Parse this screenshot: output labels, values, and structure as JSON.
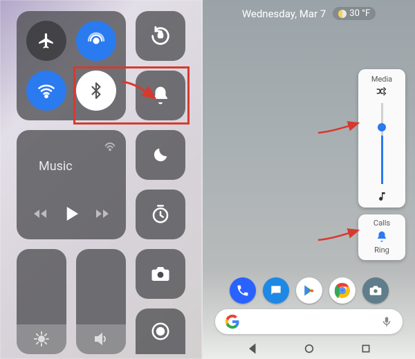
{
  "ios": {
    "toggles": {
      "airplane": {
        "name": "airplane-mode",
        "active": false
      },
      "airdrop": {
        "name": "airdrop",
        "active": true
      },
      "wifi": {
        "name": "wifi",
        "active": true
      },
      "bluetooth": {
        "name": "bluetooth",
        "active": true
      }
    },
    "orientation_lock": {
      "active": false
    },
    "ringer": {
      "name": "ringer",
      "silent": false
    },
    "music": {
      "label": "Music",
      "playing": false,
      "controls": {
        "prev": "◀◀",
        "play": "▶",
        "next": "▶▶"
      }
    },
    "dnd": {
      "active": false
    },
    "timer": {
      "active": false
    },
    "camera": {},
    "screen_record": {
      "recording": false
    },
    "brightness_pct": 28,
    "volume_pct": 28
  },
  "android": {
    "status": {
      "date": "Wednesday, Mar 7",
      "temperature": "30 °F",
      "weather_icon": "partly-sunny"
    },
    "media_panel": {
      "label": "Media",
      "shuffle_icon": "shuffle-icon",
      "volume_pct": 60,
      "note_icon": "music-note-icon"
    },
    "calls_panel": {
      "label": "Calls",
      "mode_label": "Ring",
      "icon": "bell-icon"
    },
    "dock": [
      {
        "name": "phone-app"
      },
      {
        "name": "messages-app"
      },
      {
        "name": "play-store-app"
      },
      {
        "name": "chrome-app"
      },
      {
        "name": "camera-app"
      }
    ],
    "search": {
      "glyph": "G",
      "mic_icon": "mic-icon"
    },
    "navbar": {
      "back": "back-button",
      "home": "home-button",
      "recents": "recents-button"
    }
  },
  "annotations": {
    "highlight_box": "red-highlight-box",
    "arrows": [
      "arrow-to-bell",
      "arrow-to-media",
      "arrow-to-calls"
    ]
  }
}
